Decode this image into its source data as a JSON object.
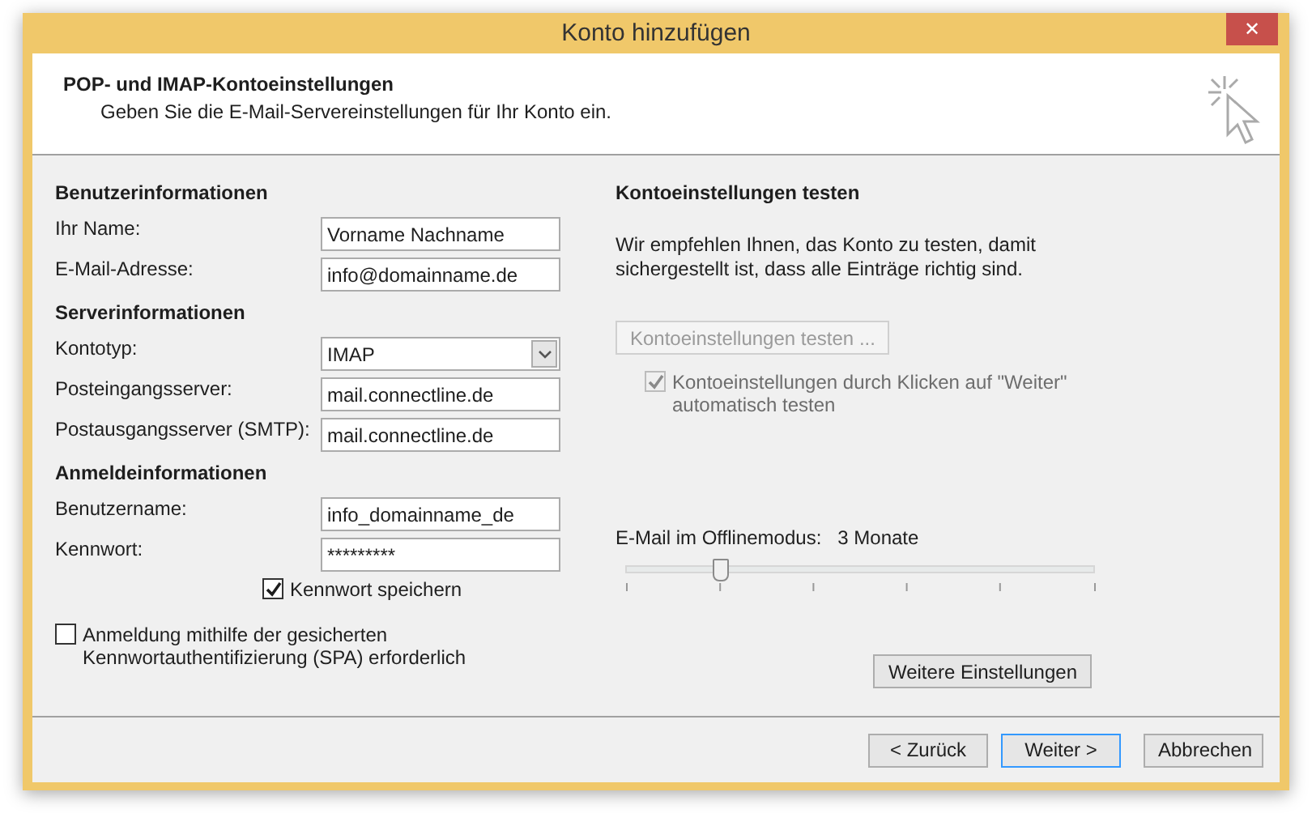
{
  "window": {
    "title": "Konto hinzufügen",
    "close": "✕"
  },
  "header": {
    "title": "POP- und IMAP-Kontoeinstellungen",
    "subtitle": "Geben Sie die E-Mail-Servereinstellungen für Ihr Konto ein."
  },
  "sections": [
    {
      "title": "Benutzerinformationen",
      "fields": [
        {
          "label": "Ihr Name:",
          "value": "Vorname Nachname",
          "kind": "text"
        },
        {
          "label": "E-Mail-Adresse:",
          "value": "info@domainname.de",
          "kind": "text"
        }
      ]
    },
    {
      "title": "Serverinformationen",
      "fields": [
        {
          "label": "Kontotyp:",
          "value": "IMAP",
          "kind": "select"
        },
        {
          "label": "Posteingangsserver:",
          "value": "mail.connectline.de",
          "kind": "text"
        },
        {
          "label": "Postausgangsserver (SMTP):",
          "value": "mail.connectline.de",
          "kind": "text"
        }
      ]
    },
    {
      "title": "Anmeldeinformationen",
      "fields": [
        {
          "label": "Benutzername:",
          "value": "info_domainname_de",
          "kind": "text"
        },
        {
          "label": "Kennwort:",
          "value": "*********",
          "kind": "text"
        }
      ]
    }
  ],
  "remember_password": {
    "label": "Kennwort speichern",
    "checked": true
  },
  "spa": {
    "label": "Anmeldung mithilfe der gesicherten Kennwortauthentifizierung (SPA) erforderlich",
    "checked": false
  },
  "test": {
    "title": "Kontoeinstellungen testen",
    "description": "Wir empfehlen Ihnen, das Konto zu testen, damit sichergestellt ist, dass alle Einträge richtig sind.",
    "button": {
      "label": "Kontoeinstellungen testen ...",
      "disabled": true
    },
    "auto": {
      "label": "Kontoeinstellungen durch Klicken auf \"Weiter\" automatisch testen",
      "checked": true,
      "disabled": true
    }
  },
  "offline": {
    "label": "E-Mail im Offlinemodus:",
    "reading": "3 Monate",
    "level": 0.2
  },
  "more_settings": "Weitere Einstellungen",
  "buttons": [
    {
      "label": "< Zurück",
      "selected": false
    },
    {
      "label": "Weiter >",
      "selected": true
    },
    {
      "label": "Abbrechen",
      "selected": false
    }
  ]
}
